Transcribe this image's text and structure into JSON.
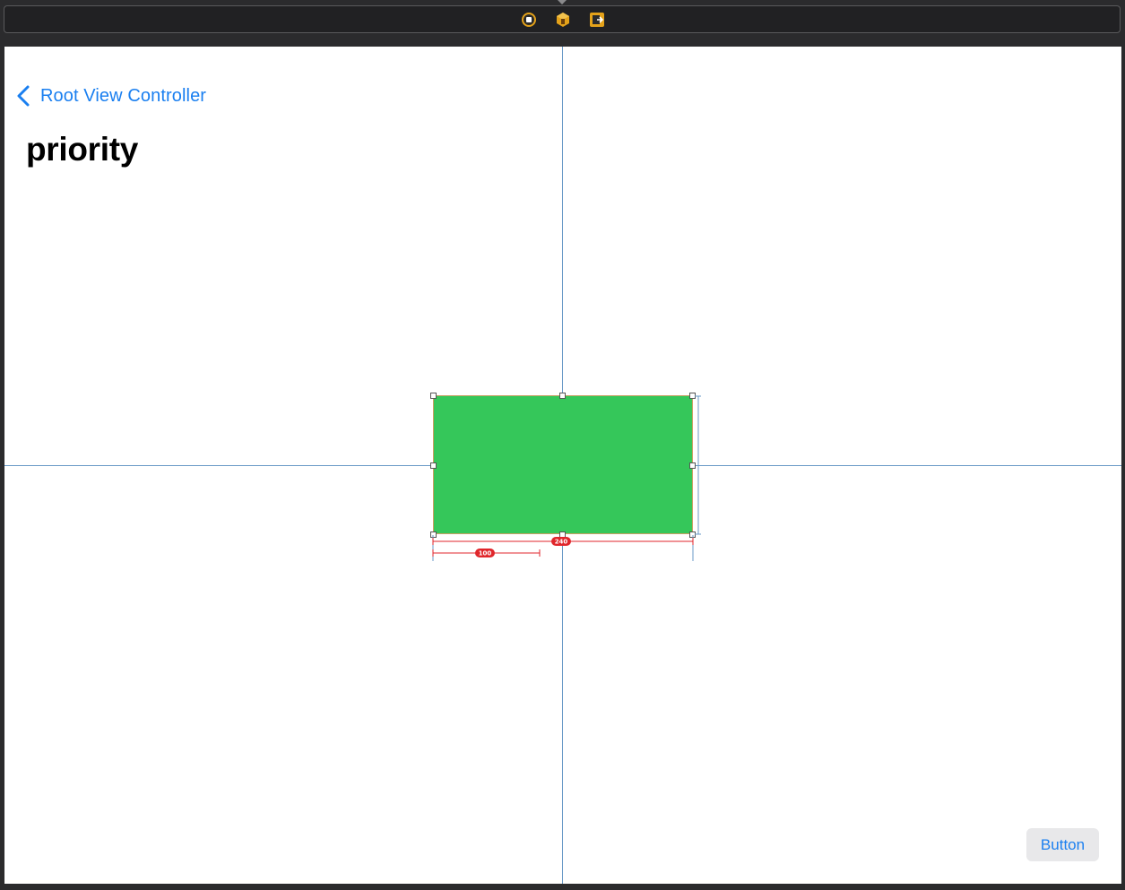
{
  "toolbar": {
    "icons": [
      "view-controller-icon",
      "first-responder-icon",
      "exit-icon"
    ]
  },
  "navigation": {
    "back_label": "Root View Controller",
    "title": "priority"
  },
  "constraints": {
    "width_badge": "240",
    "secondary_width_badge": "100"
  },
  "button": {
    "label": "Button"
  },
  "colors": {
    "accent": "#1a7ff0",
    "view_fill": "#35c75a",
    "constraint_error": "#e0262b",
    "guide": "#6a9ac7"
  }
}
